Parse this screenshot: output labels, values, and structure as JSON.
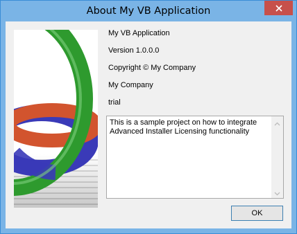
{
  "window": {
    "title": "About My VB Application",
    "close_icon": "close-icon"
  },
  "info": {
    "product_name": "My VB Application",
    "version": "Version 1.0.0.0",
    "copyright": "Copyright © My Company",
    "company": "My Company",
    "license": "trial"
  },
  "description": {
    "text": "This is a sample project on how to integrate Advanced Installer Licensing functionality"
  },
  "buttons": {
    "ok_label": "OK"
  },
  "colors": {
    "titlebar": "#7ab4e6",
    "close_button": "#c7504b",
    "dialog_background": "#f0f0f0",
    "ring_green": "#2e9a2e",
    "ring_red": "#d2542e",
    "ring_blue": "#3a3ab8"
  }
}
